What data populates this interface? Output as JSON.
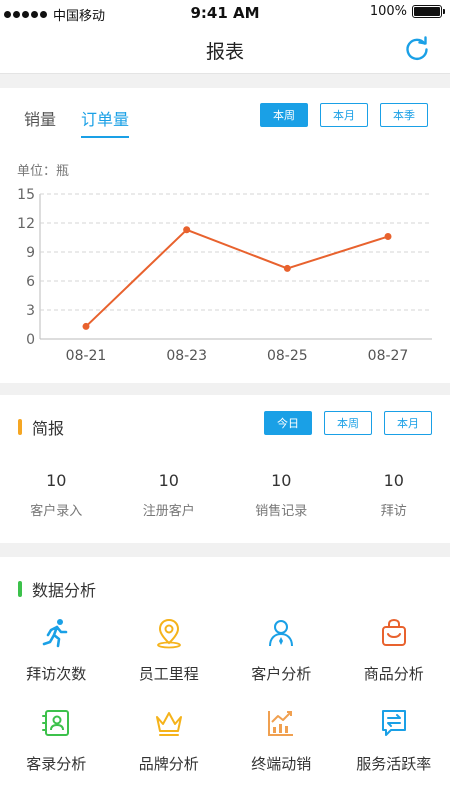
{
  "status": {
    "carrier": "中国移动",
    "time": "9:41 AM",
    "battery": "100%"
  },
  "nav": {
    "title": "报表"
  },
  "sales": {
    "tabs": [
      {
        "label": "销量"
      },
      {
        "label": "订单量"
      }
    ],
    "active_tab": 1,
    "periods": [
      {
        "label": "本周"
      },
      {
        "label": "本月"
      },
      {
        "label": "本季"
      }
    ],
    "active_period": 0,
    "unit": "单位：瓶"
  },
  "chart_data": {
    "type": "line",
    "x": [
      "08-21",
      "08-23",
      "08-25",
      "08-27"
    ],
    "series": [
      {
        "values": [
          1.3,
          11.3,
          7.3,
          10.6
        ]
      }
    ],
    "ylim": [
      0,
      15
    ],
    "yticks": [
      0,
      3,
      6,
      9,
      12,
      15
    ],
    "xlabel": "",
    "ylabel": "",
    "grid": true,
    "line_color": "#e8622e"
  },
  "brief": {
    "title": "简报",
    "accent": "#f5a623",
    "periods": [
      {
        "label": "今日"
      },
      {
        "label": "本周"
      },
      {
        "label": "本月"
      }
    ],
    "active_period": 0,
    "stats": [
      {
        "value": "10",
        "label": "客户录入"
      },
      {
        "value": "10",
        "label": "注册客户"
      },
      {
        "value": "10",
        "label": "销售记录"
      },
      {
        "value": "10",
        "label": "拜访"
      }
    ]
  },
  "analysis": {
    "title": "数据分析",
    "accent": "#3cc14b",
    "items": [
      {
        "label": "拜访次数",
        "icon": "running-person-icon",
        "color": "#1aa0e6"
      },
      {
        "label": "员工里程",
        "icon": "location-pin-icon",
        "color": "#f5b31b"
      },
      {
        "label": "客户分析",
        "icon": "users-icon",
        "color": "#1aa0e6"
      },
      {
        "label": "商品分析",
        "icon": "shopping-bag-icon",
        "color": "#e8622e"
      },
      {
        "label": "客录分析",
        "icon": "contact-card-icon",
        "color": "#3cc14b"
      },
      {
        "label": "品牌分析",
        "icon": "crown-icon",
        "color": "#f5b31b"
      },
      {
        "label": "终端动销",
        "icon": "trend-chart-icon",
        "color": "#f0a050"
      },
      {
        "label": "服务活跃率",
        "icon": "exchange-message-icon",
        "color": "#1aa0e6"
      }
    ]
  }
}
